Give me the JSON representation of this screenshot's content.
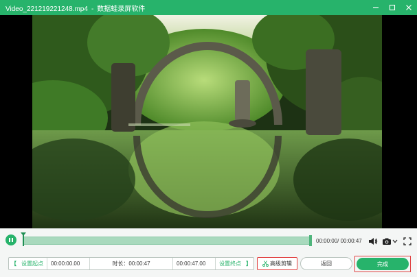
{
  "window": {
    "file_name": "Video_221219221248.mp4",
    "separator": "-",
    "app_name": "数据蛙录屏软件",
    "controls": [
      "minimize",
      "maximize",
      "close"
    ]
  },
  "player": {
    "time_display": "00:00:00/ 00:00:47",
    "progress": 0.0,
    "icons": {
      "play_pause": "pause-icon",
      "volume": "speaker-icon",
      "snapshot": "camera-icon",
      "fullscreen": "fullscreen-icon"
    }
  },
  "editor": {
    "start_bracket": "【",
    "set_start_label": "设置起点",
    "start_time": "00:00:00.00",
    "duration_label": "时长：00:00:47",
    "end_time": "00:00:47.00",
    "set_end_label": "设置终点",
    "end_bracket": "】",
    "advanced_cut_label": "高级剪辑",
    "back_label": "返回",
    "done_label": "完成"
  },
  "colors": {
    "accent": "#27b36b",
    "highlight_border": "#e03c3c"
  }
}
